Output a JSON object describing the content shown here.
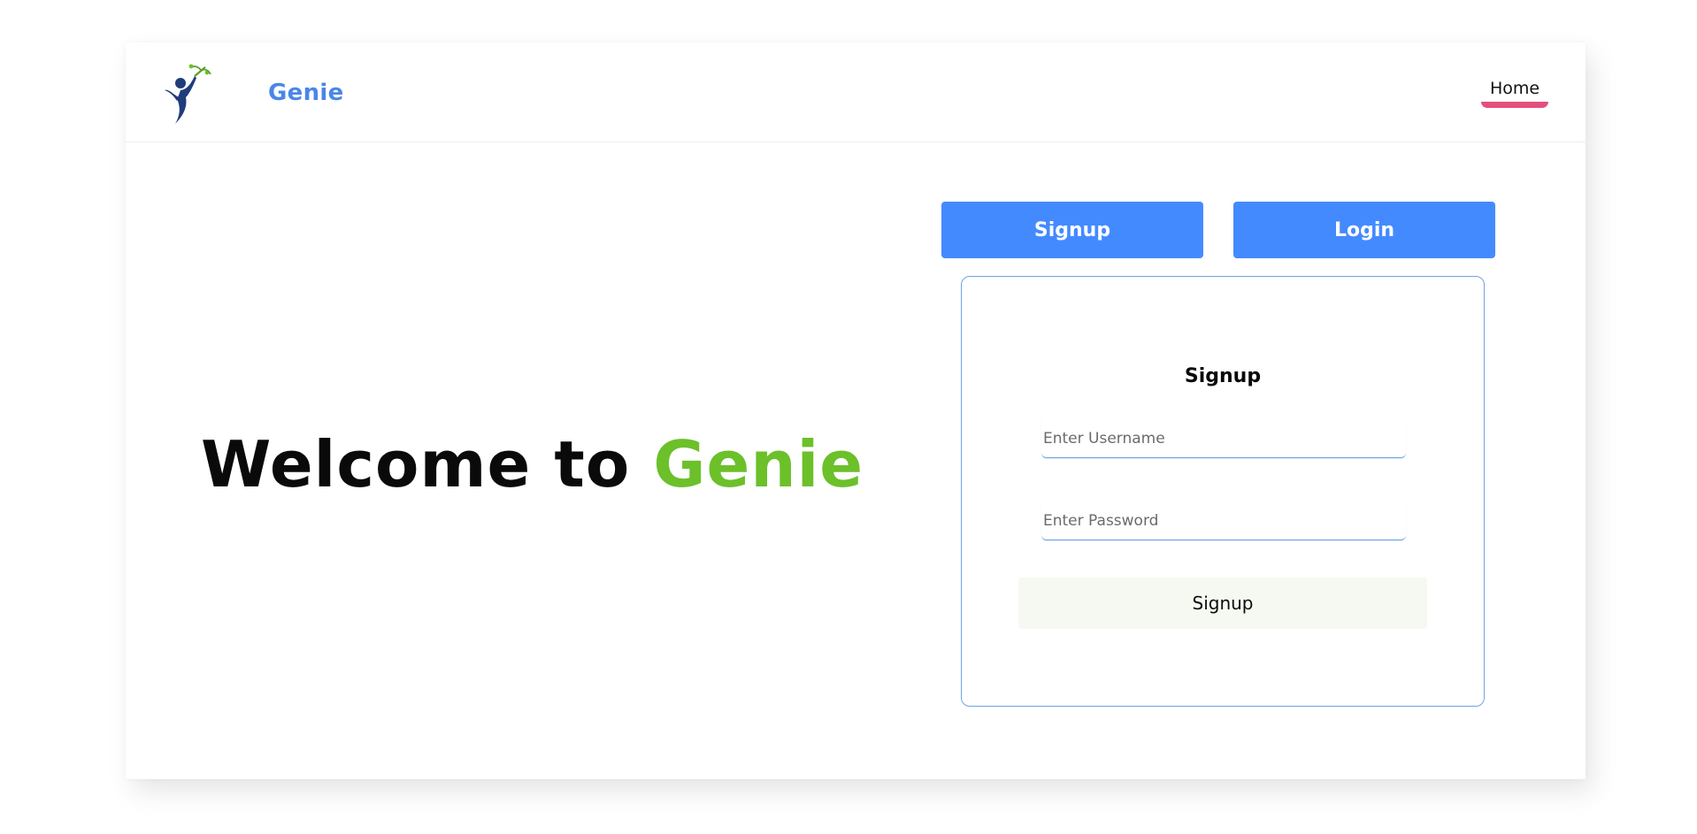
{
  "navbar": {
    "logo_icon": "genie-figure-logo-icon",
    "brand": "Genie",
    "home_link": "Home"
  },
  "hero": {
    "welcome_text": "Welcome to ",
    "welcome_accent": "Genie"
  },
  "tabs": {
    "signup_label": "Signup",
    "login_label": "Login"
  },
  "form": {
    "title": "Signup",
    "username_placeholder": "Enter Username",
    "username_value": "",
    "password_placeholder": "Enter Password",
    "password_value": "",
    "submit_label": "Signup"
  },
  "colors": {
    "brand_blue": "#4a86e8",
    "button_blue": "#448aff",
    "accent_green": "#6cc02a",
    "home_underline": "#e24f7d",
    "form_border": "#6fa2e6",
    "submit_bg": "#f6f8f2"
  }
}
